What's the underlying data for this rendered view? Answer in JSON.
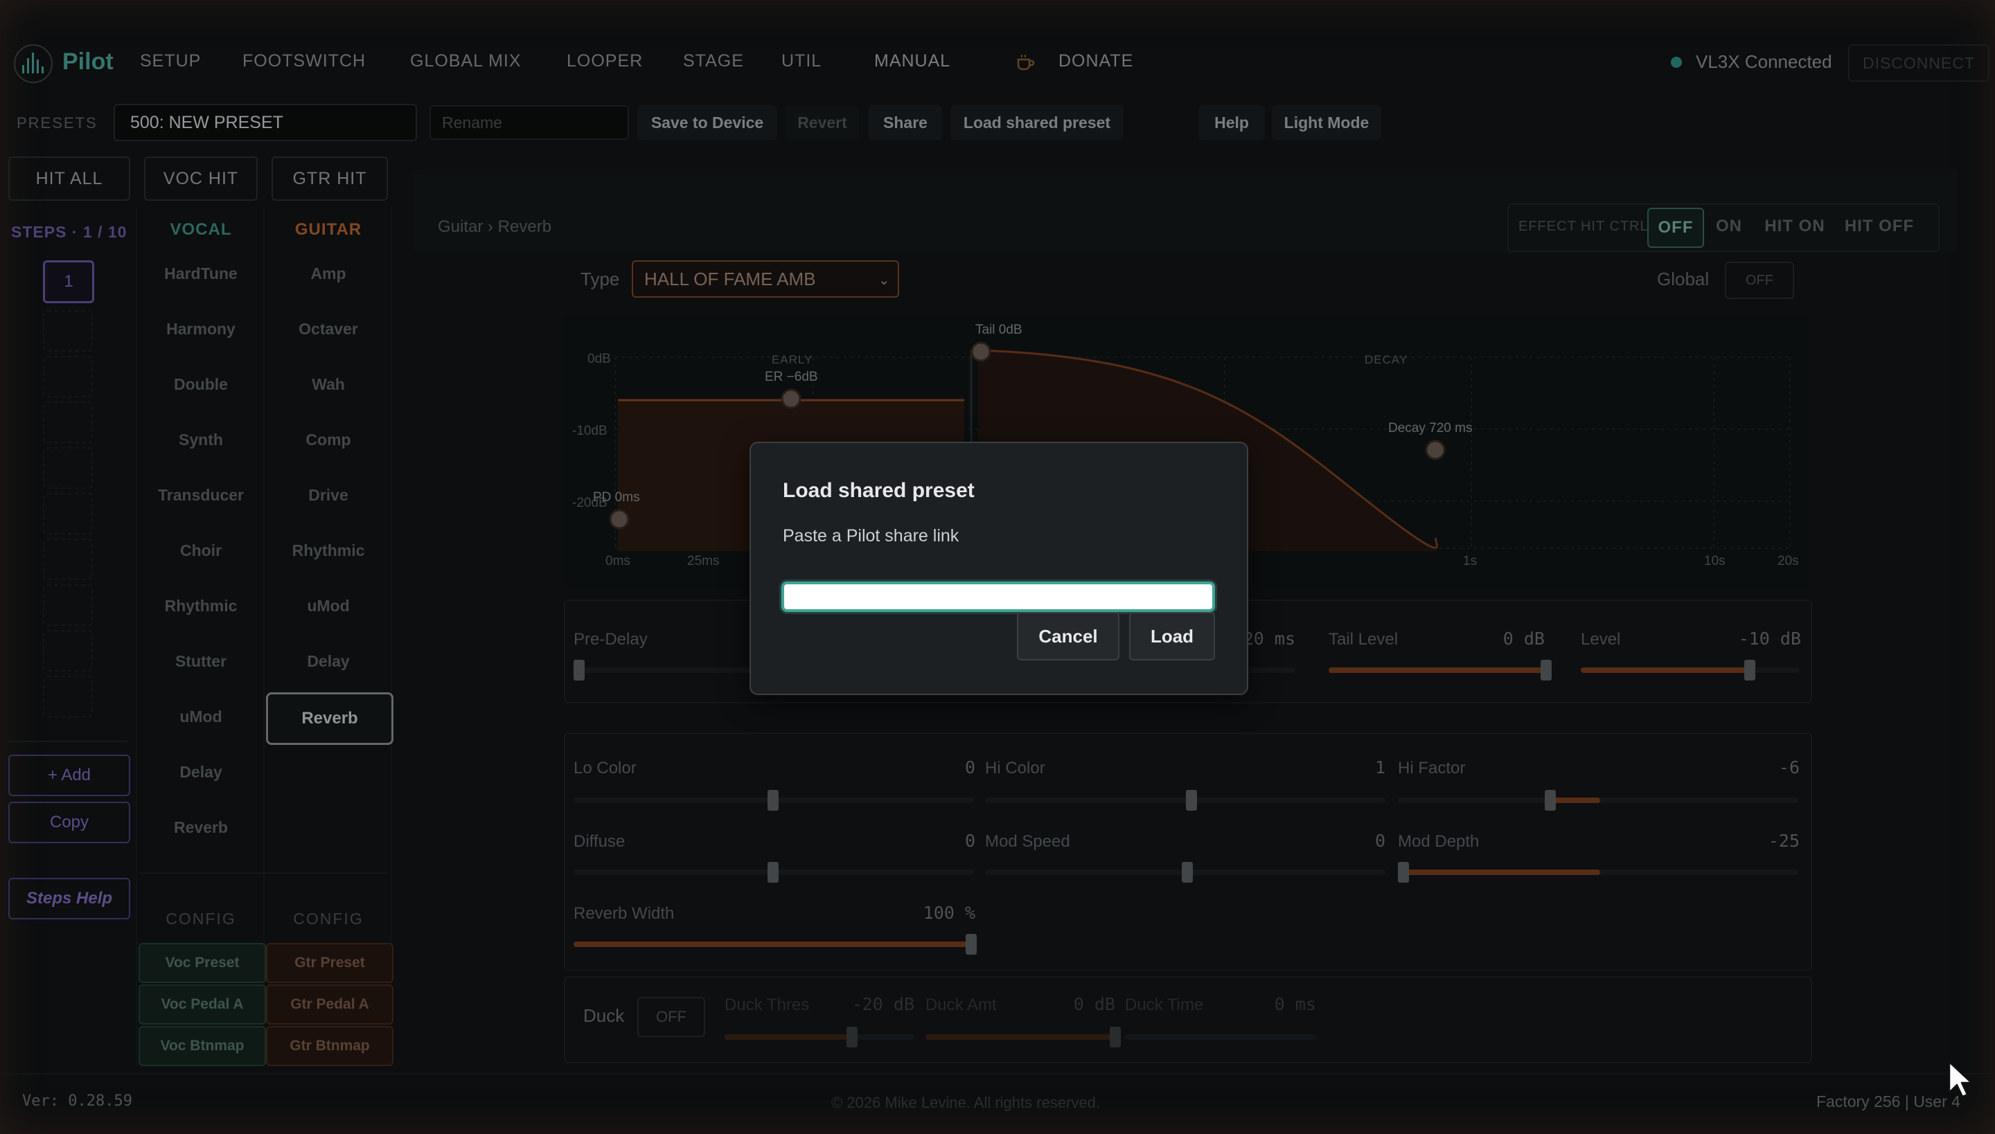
{
  "app": {
    "brand": "Pilot"
  },
  "nav": {
    "items": [
      "SETUP",
      "FOOTSWITCH",
      "GLOBAL MIX",
      "LOOPER",
      "STAGE",
      "UTIL",
      "MANUAL"
    ],
    "donate": "DONATE",
    "connection": "VL3X Connected",
    "disconnect": "DISCONNECT"
  },
  "presets": {
    "label": "PRESETS",
    "current": "500: NEW PRESET",
    "rename_placeholder": "Rename",
    "save": "Save to Device",
    "revert": "Revert",
    "share": "Share",
    "load_shared": "Load shared preset",
    "help": "Help",
    "light_mode": "Light Mode"
  },
  "left": {
    "hit_all": "HIT ALL",
    "voc_hit": "VOC HIT",
    "gtr_hit": "GTR HIT",
    "steps": "STEPS · 1 / 10",
    "active_step": "1",
    "add": "+ Add",
    "copy": "Copy",
    "steps_help": "Steps Help"
  },
  "vocal": {
    "head": "VOCAL",
    "items": [
      "HardTune",
      "Harmony",
      "Double",
      "Synth",
      "Transducer",
      "Choir",
      "Rhythmic",
      "Stutter",
      "uMod",
      "Delay",
      "Reverb"
    ],
    "config_head": "CONFIG",
    "config": [
      "Voc Preset",
      "Voc Pedal A",
      "Voc Btnmap"
    ]
  },
  "guitar": {
    "head": "GUITAR",
    "items": [
      "Amp",
      "Octaver",
      "Wah",
      "Comp",
      "Drive",
      "Rhythmic",
      "uMod",
      "Delay",
      "Reverb"
    ],
    "selected": "Reverb",
    "config_head": "CONFIG",
    "config": [
      "Gtr Preset",
      "Gtr Pedal A",
      "Gtr Btnmap"
    ]
  },
  "main": {
    "breadcrumb": "Guitar › Reverb",
    "effect_hit_ctrl": "EFFECT HIT CTRL:",
    "hit_options": [
      "OFF",
      "ON",
      "HIT ON",
      "HIT OFF"
    ],
    "hit_selected": "OFF",
    "type_label": "Type",
    "type_value": "HALL OF FAME AMB",
    "global_label": "Global",
    "global_value": "OFF"
  },
  "graph": {
    "y_labels": [
      "0dB",
      "-10dB",
      "-20dB"
    ],
    "x_labels": [
      "0ms",
      "25ms",
      "1s",
      "10s",
      "20s"
    ],
    "early_label": "EARLY",
    "decay_label": "DECAY",
    "tail_point": "Tail 0dB",
    "er_point": "ER −6dB",
    "decay_point": "Decay 720 ms",
    "pd_point": "PD 0ms"
  },
  "params_top": {
    "pre_delay": {
      "label": "Pre-Delay"
    },
    "partial_value": "20 ms",
    "tail_level": {
      "label": "Tail Level",
      "value": "0 dB",
      "level": 1.0
    },
    "level": {
      "label": "Level",
      "value": "-10 dB",
      "level": 0.76
    }
  },
  "params": {
    "lo_color": {
      "label": "Lo Color",
      "value": "0"
    },
    "hi_color": {
      "label": "Hi Color",
      "value": "1"
    },
    "hi_factor": {
      "label": "Hi Factor",
      "value": "-6"
    },
    "diffuse": {
      "label": "Diffuse",
      "value": "0"
    },
    "mod_speed": {
      "label": "Mod Speed",
      "value": "0"
    },
    "mod_depth": {
      "label": "Mod Depth",
      "value": "-25"
    },
    "reverb_width": {
      "label": "Reverb Width",
      "value": "100 %"
    }
  },
  "duck": {
    "label": "Duck",
    "toggle": "OFF",
    "thres": {
      "label": "Duck Thres",
      "value": "-20 dB"
    },
    "amt": {
      "label": "Duck Amt",
      "value": "0 dB"
    },
    "time": {
      "label": "Duck Time",
      "value": "0 ms"
    }
  },
  "footer": {
    "version": "Ver: 0.28.59",
    "copyright": "© 2026 Mike Levine. All rights reserved.",
    "counts": "Factory 256 | User 4"
  },
  "modal": {
    "title": "Load shared preset",
    "subtitle": "Paste a Pilot share link",
    "input_value": "",
    "cancel": "Cancel",
    "load": "Load"
  },
  "colors": {
    "accent_teal": "#3fa596",
    "accent_orange": "#b5652d",
    "accent_purple": "#6a57a6"
  }
}
